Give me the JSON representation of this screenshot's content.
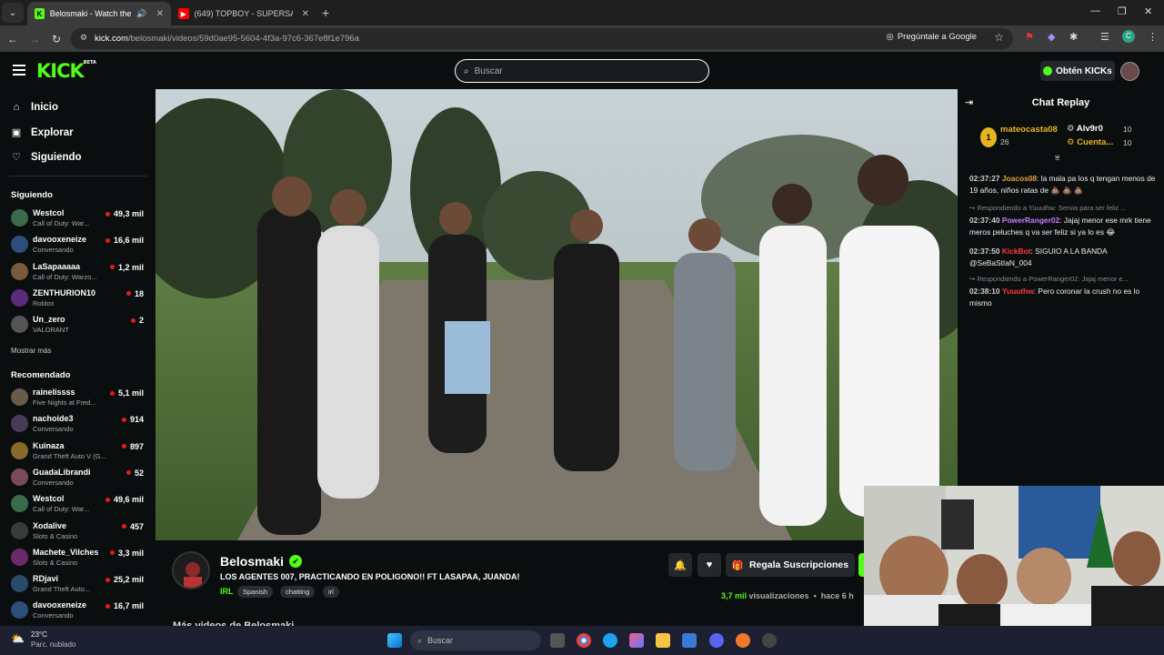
{
  "browser": {
    "tabs": [
      {
        "label": "Belosmaki - Watch the VOD",
        "active": true
      },
      {
        "label": "(649) TOPBOY - SUPERSAYAYIN",
        "active": false
      }
    ],
    "url_domain": "kick.com",
    "url_path": "/belosmaki/videos/59d0ae95-5604-4f3a-97c6-367e8f1e796a",
    "ask_google": "Pregúntale a Google"
  },
  "header": {
    "logo": "KICK",
    "logo_badge": "BETA",
    "search_placeholder": "Buscar",
    "kicks_button": "Obtén KICKs"
  },
  "sidebar": {
    "nav": [
      {
        "label": "Inicio",
        "icon": "home-icon"
      },
      {
        "label": "Explorar",
        "icon": "explore-icon"
      },
      {
        "label": "Siguiendo",
        "icon": "heart-icon"
      }
    ],
    "following_title": "Siguiendo",
    "following": [
      {
        "name": "Westcol",
        "game": "Call of Duty: War...",
        "viewers": "49,3 mil",
        "color": "#3a6b4a"
      },
      {
        "name": "davooxeneize",
        "game": "Conversando",
        "viewers": "16,6 mil",
        "color": "#2d4d7a"
      },
      {
        "name": "LaSapaaaaa",
        "game": "Call of Duty: Warzo...",
        "viewers": "1,2 mil",
        "color": "#7a5a3a"
      },
      {
        "name": "ZENTHURION10",
        "game": "Roblox",
        "viewers": "18",
        "color": "#5a2d7a"
      },
      {
        "name": "Un_zero",
        "game": "VALORANT",
        "viewers": "2",
        "color": "#555"
      }
    ],
    "show_more": "Mostrar más",
    "recommended_title": "Recomendado",
    "recommended": [
      {
        "name": "rainelissss",
        "game": "Five Nights at Fred...",
        "viewers": "5,1 mil",
        "color": "#6a5a4a"
      },
      {
        "name": "nachoide3",
        "game": "Conversando",
        "viewers": "914",
        "color": "#4a3a5a"
      },
      {
        "name": "Kuinaza",
        "game": "Grand Theft Auto V (G...",
        "viewers": "897",
        "color": "#8a6a2a"
      },
      {
        "name": "GuadaLibrandi",
        "game": "Conversando",
        "viewers": "52",
        "color": "#7a4a5a"
      },
      {
        "name": "Westcol",
        "game": "Call of Duty: War...",
        "viewers": "49,6 mil",
        "color": "#3a6b4a"
      },
      {
        "name": "Xodalive",
        "game": "Slots & Casino",
        "viewers": "457",
        "color": "#3a3a3a"
      },
      {
        "name": "Machete_Vilches",
        "game": "Slots & Casino",
        "viewers": "3,3 mil",
        "color": "#6a2a6a"
      },
      {
        "name": "RDjavi",
        "game": "Grand Theft Auto...",
        "viewers": "25,2 mil",
        "color": "#2a4a6a"
      },
      {
        "name": "davooxeneize",
        "game": "Conversando",
        "viewers": "16,7 mil",
        "color": "#2d4d7a"
      }
    ]
  },
  "stream": {
    "streamer": "Belosmaki",
    "title": "LOS AGENTES 007, PRACTICANDO EN POLIGONO!! FT LASAPAA, JUANDA!",
    "category": "IRL",
    "tags": [
      "Spanish",
      "chatting",
      "irl"
    ],
    "gift_button": "Regala Suscripciones",
    "views": "3,7 mil",
    "views_label": "visualizaciones",
    "time_ago": "hace 6 h",
    "more_videos": "Más videos de Belosmaki"
  },
  "chat": {
    "title": "Chat Replay",
    "top_gifter": {
      "rank": "1",
      "name": "mateocasta08",
      "count": "26"
    },
    "gifters": [
      {
        "name": "Alv9r0",
        "count": "10"
      },
      {
        "name": "Cuenta...",
        "count": "10"
      }
    ],
    "messages": [
      {
        "time": "02:37:27",
        "user": "Joacos08",
        "color": "#e6a23c",
        "text": "la mala pa los q tengan menos de 19 años, niños ratas de 💩 💩 💩"
      },
      {
        "reply": "Respondiendo a Yuuuthw: Servia para ser feliz ...",
        "time": "02:37:40",
        "user": "PowerRanger02",
        "color": "#c77dff",
        "text": "Jajaj menor ese mrk tiene meros peluches q va ser feliz si ya lo es 😂"
      },
      {
        "time": "02:37:50",
        "user": "KickBot",
        "color": "#ff3b3b",
        "text": "SIGUIO A LA BANDA @SeBaStIaN_004"
      },
      {
        "reply": "Respondiendo a PowerRanger02: Jajaj menor e...",
        "time": "02:38:10",
        "user": "Yuuuthw",
        "color": "#ff3b3b",
        "text": "Pero coronar la crush no es lo mismo"
      }
    ]
  },
  "taskbar": {
    "temp": "23°C",
    "weather": "Parc. nublado",
    "search_placeholder": "Buscar"
  },
  "colors": {
    "accent": "#53fc18",
    "bg": "#0b0e0f",
    "live": "#e91916"
  }
}
